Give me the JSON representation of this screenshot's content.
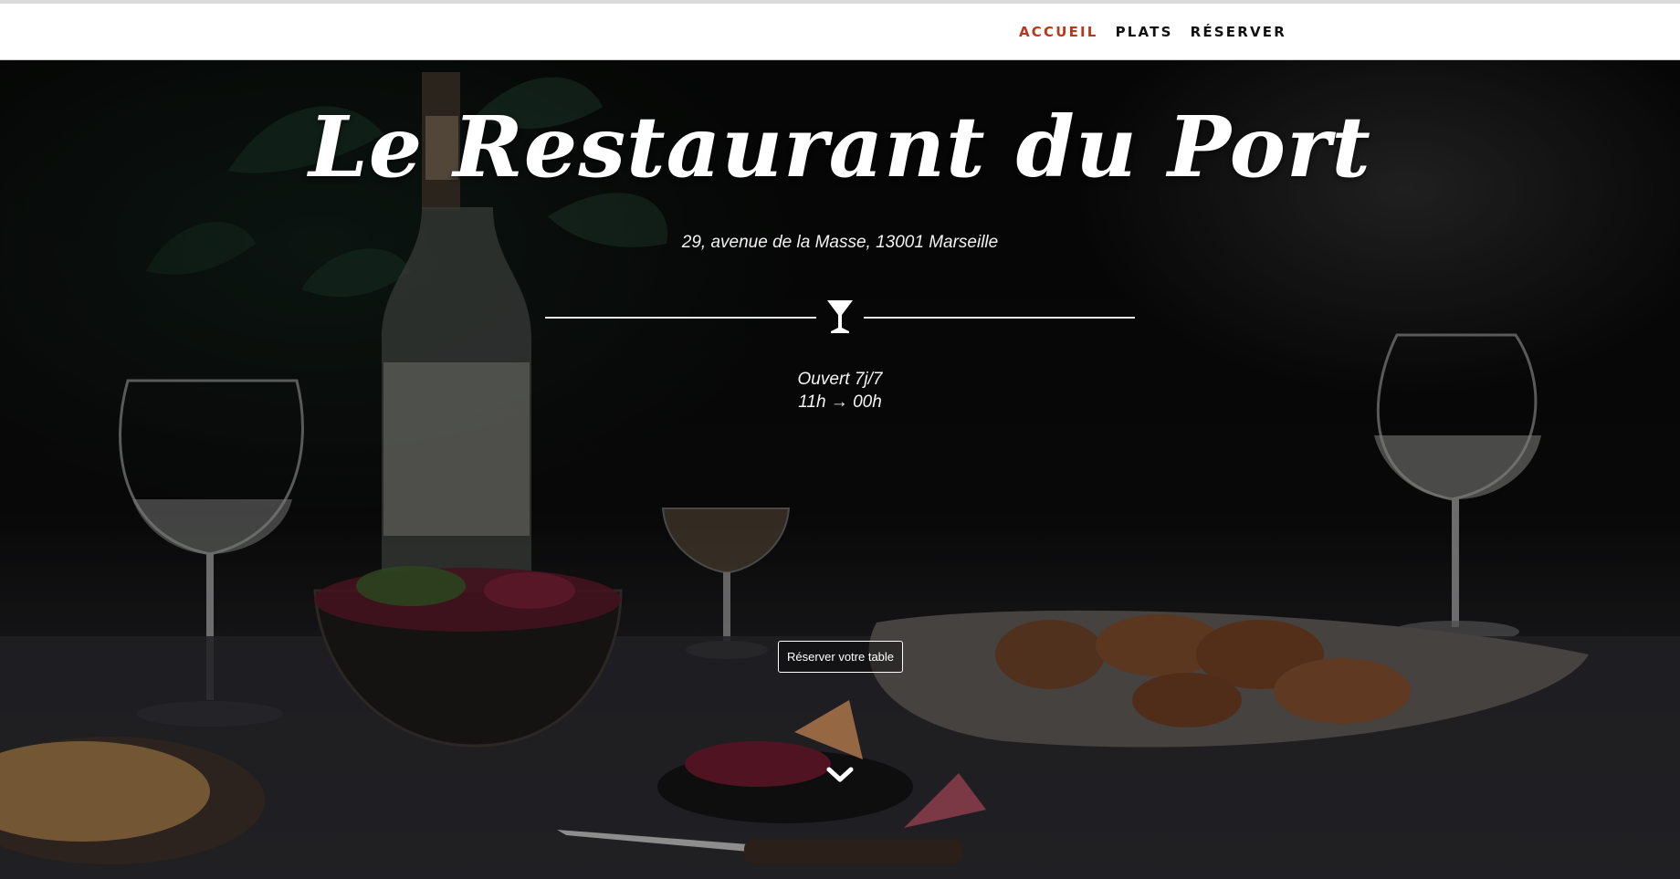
{
  "nav": {
    "items": [
      {
        "label": "ACCUEIL",
        "active": true
      },
      {
        "label": "PLATS",
        "active": false
      },
      {
        "label": "RÉSERVER",
        "active": false
      }
    ],
    "active_color": "#b43a1e"
  },
  "hero": {
    "title": "Le Restaurant du Port",
    "address": "29, avenue de la Masse, 13001 Marseille",
    "divider_icon": "cocktail-glass-icon",
    "hours": {
      "line1": "Ouvert 7j/7",
      "line2": "11h → 00h"
    },
    "cta_label": "Réserver votre table",
    "scroll_icon": "chevron-down-icon",
    "background_image": "dark table with wine bottle, wine glasses, salad bowl, grilled chicken platter and knife"
  }
}
